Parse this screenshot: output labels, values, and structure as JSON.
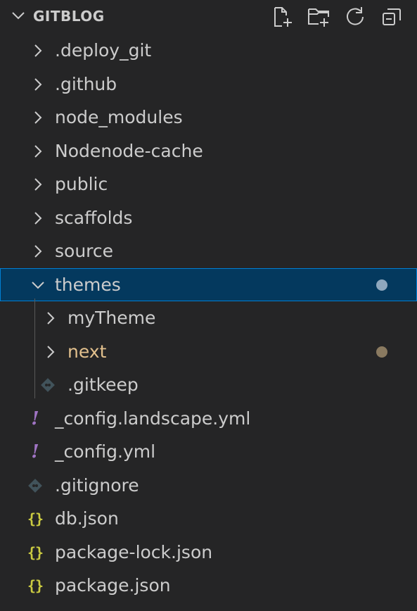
{
  "explorer": {
    "title": "GITBLOG",
    "actions": [
      {
        "icon": "new-file-icon"
      },
      {
        "icon": "new-folder-icon"
      },
      {
        "icon": "refresh-icon"
      },
      {
        "icon": "collapse-all-icon"
      }
    ]
  },
  "colors": {
    "background": "#252526",
    "selected_bg": "#04395e",
    "selected_border": "#007fd4",
    "text": "#cccccc",
    "modified_text": "#e2c08d",
    "yaml_icon": "#a074c4",
    "json_icon": "#cbcb41",
    "git_icon": "#41535b"
  },
  "tree": [
    {
      "label": ".deploy_git",
      "type": "folder",
      "expanded": false,
      "depth": 0
    },
    {
      "label": ".github",
      "type": "folder",
      "expanded": false,
      "depth": 0
    },
    {
      "label": "node_modules",
      "type": "folder",
      "expanded": false,
      "depth": 0
    },
    {
      "label": "Nodenode-cache",
      "type": "folder",
      "expanded": false,
      "depth": 0
    },
    {
      "label": "public",
      "type": "folder",
      "expanded": false,
      "depth": 0
    },
    {
      "label": "scaffolds",
      "type": "folder",
      "expanded": false,
      "depth": 0
    },
    {
      "label": "source",
      "type": "folder",
      "expanded": false,
      "depth": 0
    },
    {
      "label": "themes",
      "type": "folder",
      "expanded": true,
      "depth": 0,
      "selected": true,
      "badge": "dot",
      "badge_color": "#8fa7bd"
    },
    {
      "label": "myTheme",
      "type": "folder",
      "expanded": false,
      "depth": 1
    },
    {
      "label": "next",
      "type": "folder",
      "expanded": false,
      "depth": 1,
      "modified": true,
      "badge": "dot",
      "badge_color": "#8a7a60"
    },
    {
      "label": ".gitkeep",
      "type": "git-file",
      "depth": 1
    },
    {
      "label": "_config.landscape.yml",
      "type": "yaml-file",
      "depth": 0
    },
    {
      "label": "_config.yml",
      "type": "yaml-file",
      "depth": 0
    },
    {
      "label": ".gitignore",
      "type": "git-file",
      "depth": 0
    },
    {
      "label": "db.json",
      "type": "json-file",
      "depth": 0
    },
    {
      "label": "package-lock.json",
      "type": "json-file",
      "depth": 0
    },
    {
      "label": "package.json",
      "type": "json-file",
      "depth": 0
    }
  ]
}
